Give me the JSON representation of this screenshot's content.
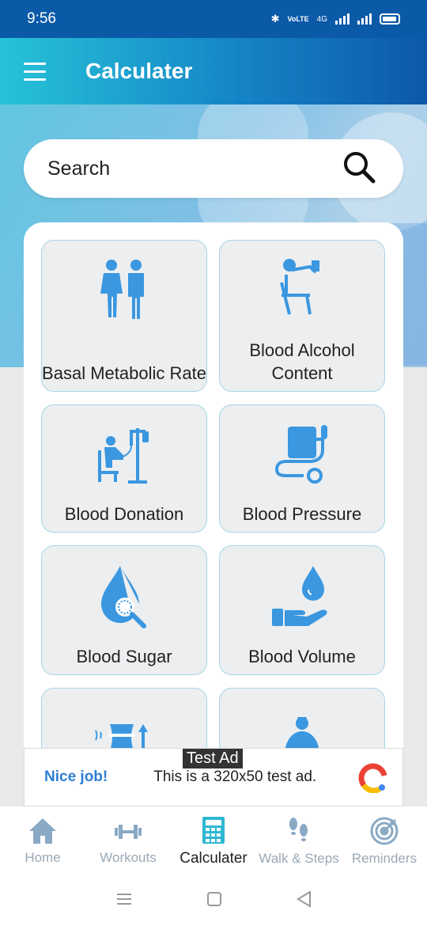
{
  "status_bar": {
    "time": "9:56",
    "network": "4G",
    "volte": "VoLTE"
  },
  "app_bar": {
    "title": "Calculater"
  },
  "search": {
    "placeholder": "Search"
  },
  "calculators": [
    {
      "label": "Basal Metabolic Rate",
      "icon": "couple-icon"
    },
    {
      "label": "Blood Alcohol Content",
      "icon": "drinking-person-icon"
    },
    {
      "label": "Blood Donation",
      "icon": "blood-donation-icon"
    },
    {
      "label": "Blood Pressure",
      "icon": "blood-pressure-icon"
    },
    {
      "label": "Blood Sugar",
      "icon": "blood-sugar-icon"
    },
    {
      "label": "Blood Volume",
      "icon": "blood-volume-icon"
    },
    {
      "label": "",
      "icon": "waist-measure-icon"
    },
    {
      "label": "",
      "icon": "body-fat-icon"
    }
  ],
  "ad": {
    "badge": "Test Ad",
    "title": "Nice job!",
    "text": "This is a 320x50 test ad."
  },
  "bottom_nav": [
    {
      "label": "Home",
      "icon": "home-icon"
    },
    {
      "label": "Workouts",
      "icon": "dumbbell-icon"
    },
    {
      "label": "Calculater",
      "icon": "calculator-icon",
      "active": true
    },
    {
      "label": "Walk & Steps",
      "icon": "footsteps-icon"
    },
    {
      "label": "Reminders",
      "icon": "target-icon"
    }
  ],
  "colors": {
    "accent": "#3a97e0",
    "app_bar_start": "#27c3d8",
    "app_bar_end": "#0d58a8",
    "tile_border": "#a6d6e6"
  }
}
